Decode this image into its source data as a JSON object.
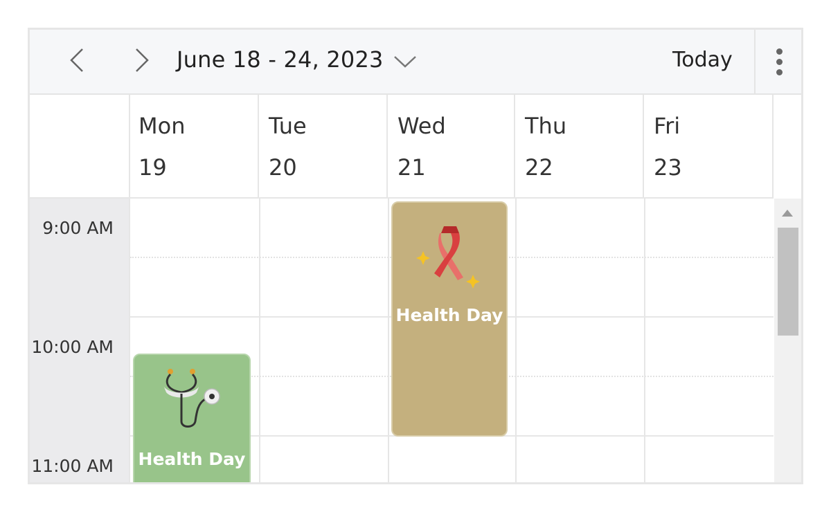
{
  "toolbar": {
    "date_range": "June 18 - 24, 2023",
    "today_label": "Today",
    "prev_icon": "chevron-left-icon",
    "next_icon": "chevron-right-icon",
    "dropdown_icon": "chevron-down-icon",
    "more_icon": "more-vertical-icon"
  },
  "days": [
    {
      "name": "Mon",
      "num": "19"
    },
    {
      "name": "Tue",
      "num": "20"
    },
    {
      "name": "Wed",
      "num": "21"
    },
    {
      "name": "Thu",
      "num": "22"
    },
    {
      "name": "Fri",
      "num": "23"
    }
  ],
  "times": [
    "9:00 AM",
    "10:00 AM",
    "11:00 AM"
  ],
  "events": [
    {
      "title": "Health Day",
      "day": "Wed",
      "color": "#c4b07e",
      "icon": "awareness-ribbon-icon"
    },
    {
      "title": "Health Day",
      "day": "Mon",
      "color": "#98c48a",
      "icon": "stethoscope-icon"
    }
  ]
}
